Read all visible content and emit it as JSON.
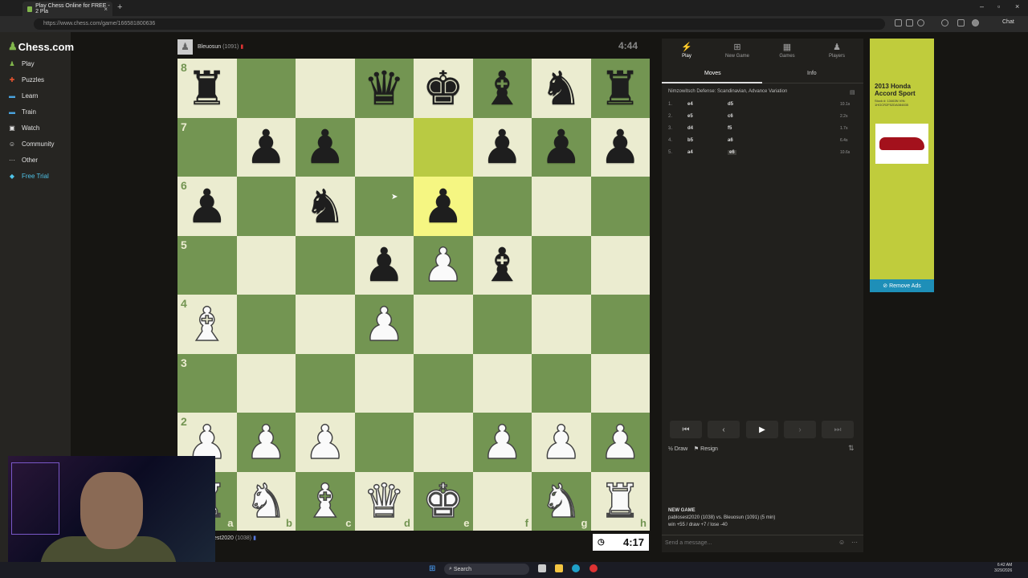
{
  "browser": {
    "tab_title": "Play Chess Online for FREE - 2 Pla",
    "tab_close": "×",
    "new_tab": "+",
    "url": "https://www.chess.com/game/166581800636",
    "chat_label": "Chat",
    "window_controls": [
      "–",
      "▫",
      "×"
    ]
  },
  "sidebar": {
    "logo": "Chess.com",
    "items": [
      {
        "label": "Play",
        "icon": "play-icon",
        "color": "#81b64c"
      },
      {
        "label": "Puzzles",
        "icon": "puzzle-icon",
        "color": "#e5532f"
      },
      {
        "label": "Learn",
        "icon": "learn-icon",
        "color": "#4aa3df"
      },
      {
        "label": "Train",
        "icon": "train-icon",
        "color": "#4aa3df"
      },
      {
        "label": "Watch",
        "icon": "watch-icon",
        "color": "#e2e2e2"
      },
      {
        "label": "Community",
        "icon": "community-icon",
        "color": "#e2e2e2"
      },
      {
        "label": "Other",
        "icon": "more-icon",
        "color": "#e2e2e2"
      },
      {
        "label": "Free Trial",
        "icon": "diamond-icon",
        "color": "#4fc3e8"
      }
    ]
  },
  "game": {
    "top_player": {
      "name": "Bleuosun",
      "rating": "(1091)",
      "clock": "4:44"
    },
    "bottom_player": {
      "name": "est2020",
      "rating": "(1038)",
      "clock": "4:17"
    },
    "board": [
      [
        "r",
        "",
        "",
        "q",
        "k",
        "b",
        "n",
        "r"
      ],
      [
        "",
        "p",
        "p",
        "",
        "",
        "p",
        "p",
        "p"
      ],
      [
        "p",
        "",
        "n",
        "",
        "p",
        "",
        "",
        ""
      ],
      [
        "",
        "",
        "",
        "p",
        "P",
        "b",
        "",
        ""
      ],
      [
        "B",
        "",
        "",
        "P",
        "",
        "",
        "",
        ""
      ],
      [
        "",
        "",
        "",
        "",
        "",
        "",
        "",
        ""
      ],
      [
        "P",
        "P",
        "P",
        "",
        "",
        "P",
        "P",
        "P"
      ],
      [
        "R",
        "N",
        "B",
        "Q",
        "K",
        "",
        "N",
        "R"
      ]
    ],
    "highlights": [
      "e7",
      "e6"
    ],
    "ranks": [
      "8",
      "7",
      "6",
      "5",
      "4",
      "3",
      "2",
      "1"
    ],
    "files": [
      "a",
      "b",
      "c",
      "d",
      "e",
      "f",
      "g",
      "h"
    ]
  },
  "panel": {
    "tabs": [
      {
        "label": "Play",
        "icon": "lightning-icon"
      },
      {
        "label": "New Game",
        "icon": "plus-icon"
      },
      {
        "label": "Games",
        "icon": "games-icon"
      },
      {
        "label": "Players",
        "icon": "players-icon"
      }
    ],
    "subtabs": [
      "Moves",
      "Info"
    ],
    "opening": "Nimzowitsch Defense: Scandinavian, Advance Variation",
    "moves": [
      {
        "num": "1.",
        "white": "e4",
        "black": "d5",
        "time": "10.1s"
      },
      {
        "num": "2.",
        "white": "e5",
        "black": "c6",
        "time": "2.2s"
      },
      {
        "num": "3.",
        "white": "d4",
        "black": "f5",
        "time": "1.7s"
      },
      {
        "num": "4.",
        "white": "b5",
        "black": "a6",
        "time": "6.4s"
      },
      {
        "num": "5.",
        "white": "a4",
        "black": "e6",
        "time": "10.6s"
      }
    ],
    "draw_label": "Draw",
    "resign_label": "Resign",
    "new_game_title": "NEW GAME",
    "new_game_line": "pablosest2020 (1038) vs. Bleuosun (1091) (5 min)",
    "new_game_stats": "win +55 / draw +7 / lose -40",
    "message_placeholder": "Send a message..."
  },
  "ad": {
    "title": "2013 Honda Accord Sport",
    "small": "Stock #: 13463N VIN: 1HGCR2F52DA084835",
    "remove_ads": "Remove Ads"
  },
  "taskbar": {
    "search": "Search",
    "time": "6:42 AM",
    "date": "3/29/2026"
  }
}
